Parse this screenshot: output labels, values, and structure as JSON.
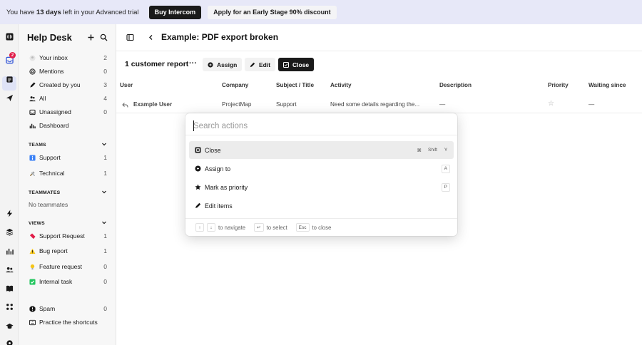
{
  "banner": {
    "trial_prefix": "You have ",
    "trial_days": "13 days",
    "trial_suffix": " left in your Advanced trial",
    "buy_label": "Buy Intercom",
    "discount_label": "Apply for an Early Stage 90% discount"
  },
  "rail": {
    "inbox_badge": "2"
  },
  "sidebar": {
    "title": "Help Desk",
    "inbox_items": [
      {
        "label": "Your inbox",
        "count": "2"
      },
      {
        "label": "Mentions",
        "count": "0"
      },
      {
        "label": "Created by you",
        "count": "3"
      },
      {
        "label": "All",
        "count": "4"
      },
      {
        "label": "Unassigned",
        "count": "0"
      },
      {
        "label": "Dashboard",
        "count": ""
      }
    ],
    "teams_header": "TEAMS",
    "teams": [
      {
        "label": "Support",
        "count": "1",
        "emoji": "ℹ️"
      },
      {
        "label": "Technical",
        "count": "1",
        "emoji": "🛠️"
      }
    ],
    "teammates_header": "TEAMMATES",
    "no_teammates": "No teammates",
    "views_header": "VIEWS",
    "views": [
      {
        "label": "Support Request",
        "count": "1",
        "emoji": "🎟️"
      },
      {
        "label": "Bug report",
        "count": "1",
        "emoji": "⚠️"
      },
      {
        "label": "Feature request",
        "count": "0",
        "emoji": "💡"
      },
      {
        "label": "Internal task",
        "count": "0",
        "emoji": "✅"
      }
    ],
    "spam": {
      "label": "Spam",
      "count": "0"
    },
    "shortcuts": "Practice the shortcuts"
  },
  "main": {
    "title": "Example: PDF export broken",
    "report_title": "1 customer report",
    "more": "···",
    "assign_label": "Assign",
    "edit_label": "Edit",
    "close_label": "Close",
    "columns": [
      "User",
      "Company",
      "Subject / Title",
      "Activity",
      "Description",
      "Priority",
      "Waiting since"
    ],
    "row": {
      "user": "Example User",
      "company": "ProjectMap",
      "subject": "Support",
      "activity": "Need some details regarding the...",
      "description": "—",
      "priority": "☆",
      "waiting": "—"
    }
  },
  "palette": {
    "placeholder": "Search actions",
    "items": [
      {
        "label": "Close",
        "keys": [
          "⌘",
          "Shift",
          "Y"
        ]
      },
      {
        "label": "Assign to",
        "keys": [
          "A"
        ]
      },
      {
        "label": "Mark as priority",
        "keys": [
          "P"
        ]
      },
      {
        "label": "Edit items",
        "keys": []
      }
    ],
    "footer": {
      "up": "↑",
      "down": "↓",
      "navigate": "to navigate",
      "enter": "↵",
      "select": "to select",
      "esc": "Esc",
      "close": "to close"
    }
  }
}
